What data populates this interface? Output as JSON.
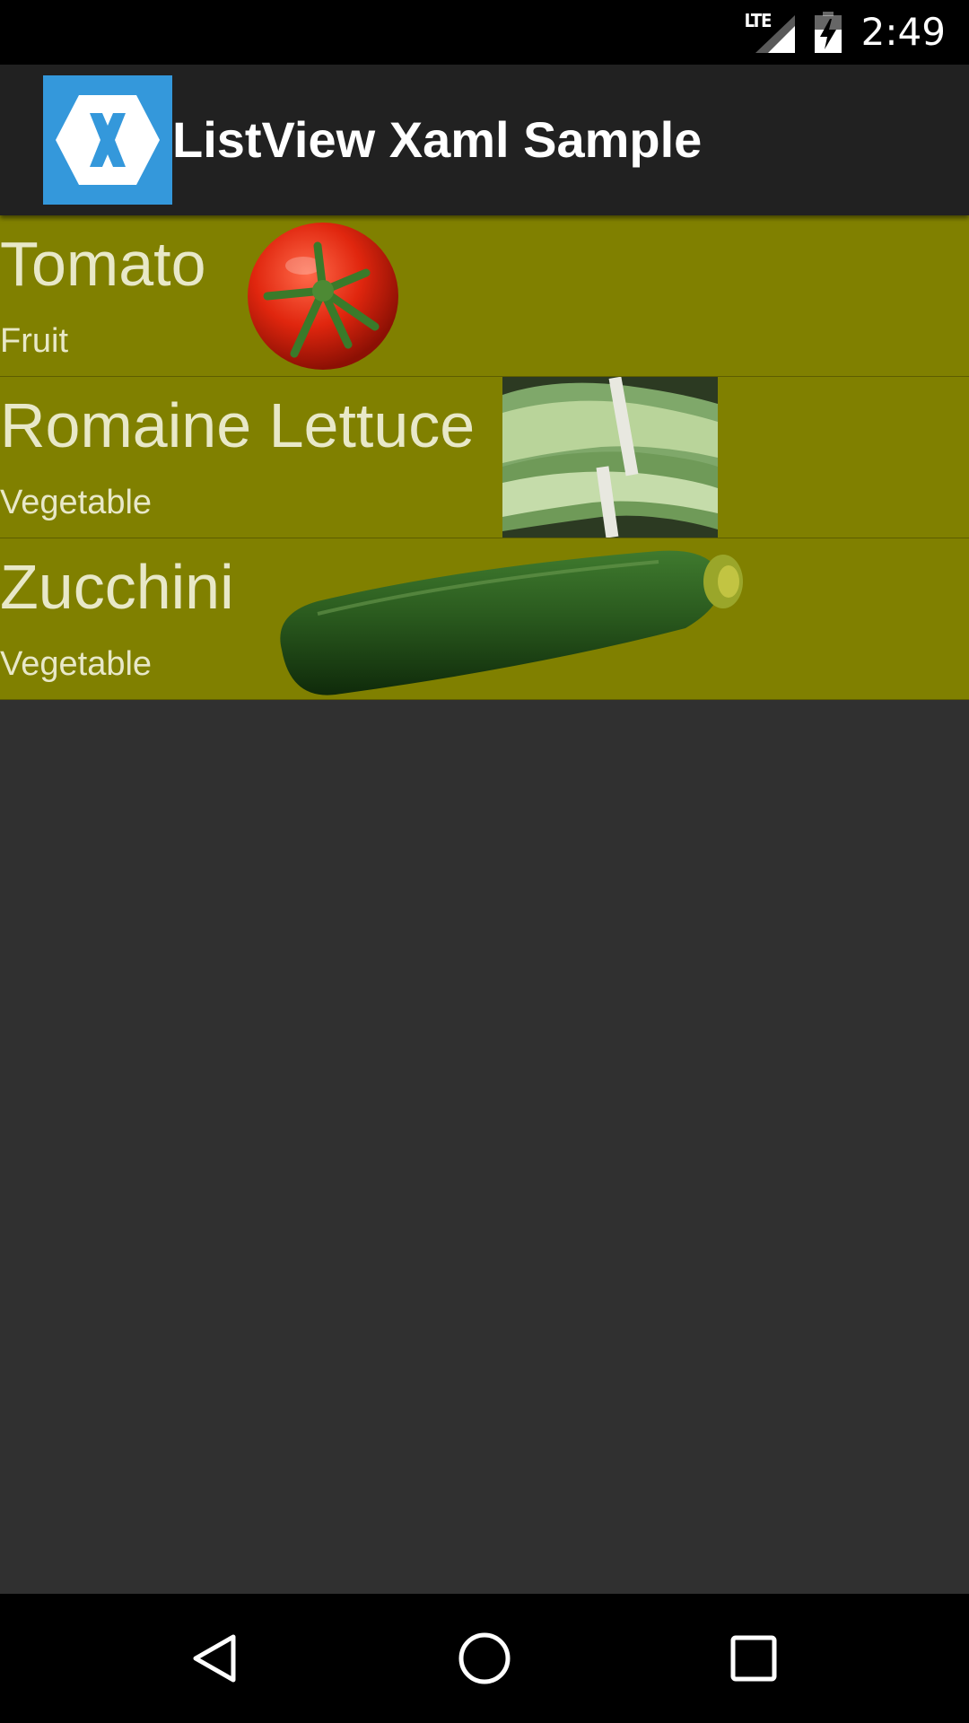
{
  "status_bar": {
    "network_label": "LTE",
    "clock": "2:49",
    "icons": [
      "lte-signal-icon",
      "battery-charging-icon"
    ]
  },
  "action_bar": {
    "title": "ListView Xaml Sample",
    "app_icon": "xamarin-logo-icon",
    "app_icon_color": "#3498db"
  },
  "list": {
    "row_color": "#808000",
    "items": [
      {
        "name": "Tomato",
        "type": "Fruit",
        "image": "tomato-image"
      },
      {
        "name": "Romaine Lettuce",
        "type": "Vegetable",
        "image": "romaine-lettuce-image"
      },
      {
        "name": "Zucchini",
        "type": "Vegetable",
        "image": "zucchini-image"
      }
    ]
  },
  "nav_bar": {
    "buttons": [
      "back-icon",
      "home-icon",
      "recents-icon"
    ]
  }
}
